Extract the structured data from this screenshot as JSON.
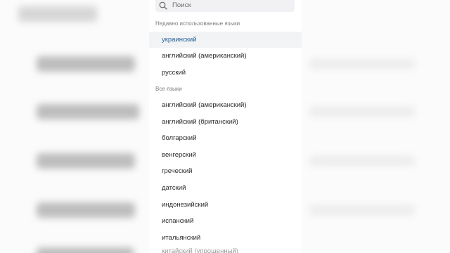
{
  "search": {
    "placeholder": "Поиск",
    "icon": "search-icon"
  },
  "recent": {
    "header": "Недавно использованные языки",
    "items": [
      {
        "label": "украинский",
        "selected": true
      },
      {
        "label": "английский (американский)"
      },
      {
        "label": "русский"
      }
    ]
  },
  "all": {
    "header": "Все языки",
    "items": [
      {
        "label": "английский (американский)"
      },
      {
        "label": "английский (британский)"
      },
      {
        "label": "болгарский"
      },
      {
        "label": "венгерский"
      },
      {
        "label": "греческий"
      },
      {
        "label": "датский"
      },
      {
        "label": "индонезийский"
      },
      {
        "label": "испанский"
      },
      {
        "label": "итальянский"
      },
      {
        "label": "китайский (упрощенный)"
      }
    ]
  },
  "colors": {
    "selected_text": "#1f5f9a",
    "selected_bg": "#f2f3f5",
    "search_bg": "#f1f1f3"
  }
}
